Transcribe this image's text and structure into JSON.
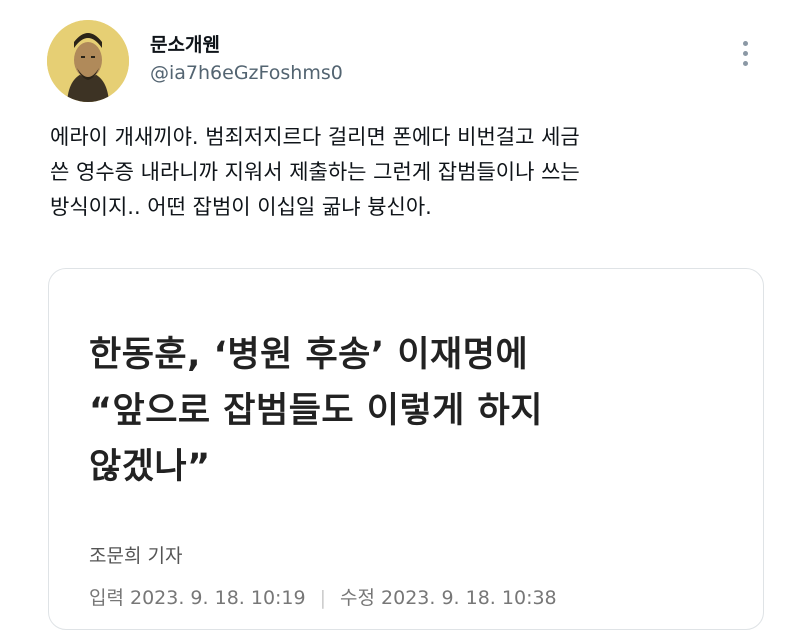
{
  "user": {
    "display_name": "문소개웬",
    "handle": "@ia7h6eGzFoshms0",
    "avatar_icon": "portrait-avatar"
  },
  "tweet": {
    "lines": [
      "에라이 개새끼야. 범죄저지르다 걸리면 폰에다 비번걸고 세금",
      "쓴 영수증 내라니까 지워서 제출하는 그런게 잡범들이나 쓰는",
      "방식이지.. 어떤 잡범이 이십일 굶냐 븅신아."
    ]
  },
  "article_card": {
    "headline_lines": [
      "한동훈, ‘병원 후송’ 이재명에",
      "“앞으로 잡범들도 이렇게 하지",
      "않겠나”"
    ],
    "reporter": "조문희 기자",
    "published": "입력 2023. 9. 18. 10:19",
    "modified": "수정 2023. 9. 18. 10:38"
  },
  "colors": {
    "text": "#0f1419",
    "secondary_text": "#536471",
    "card_border": "#dfe3e6"
  }
}
